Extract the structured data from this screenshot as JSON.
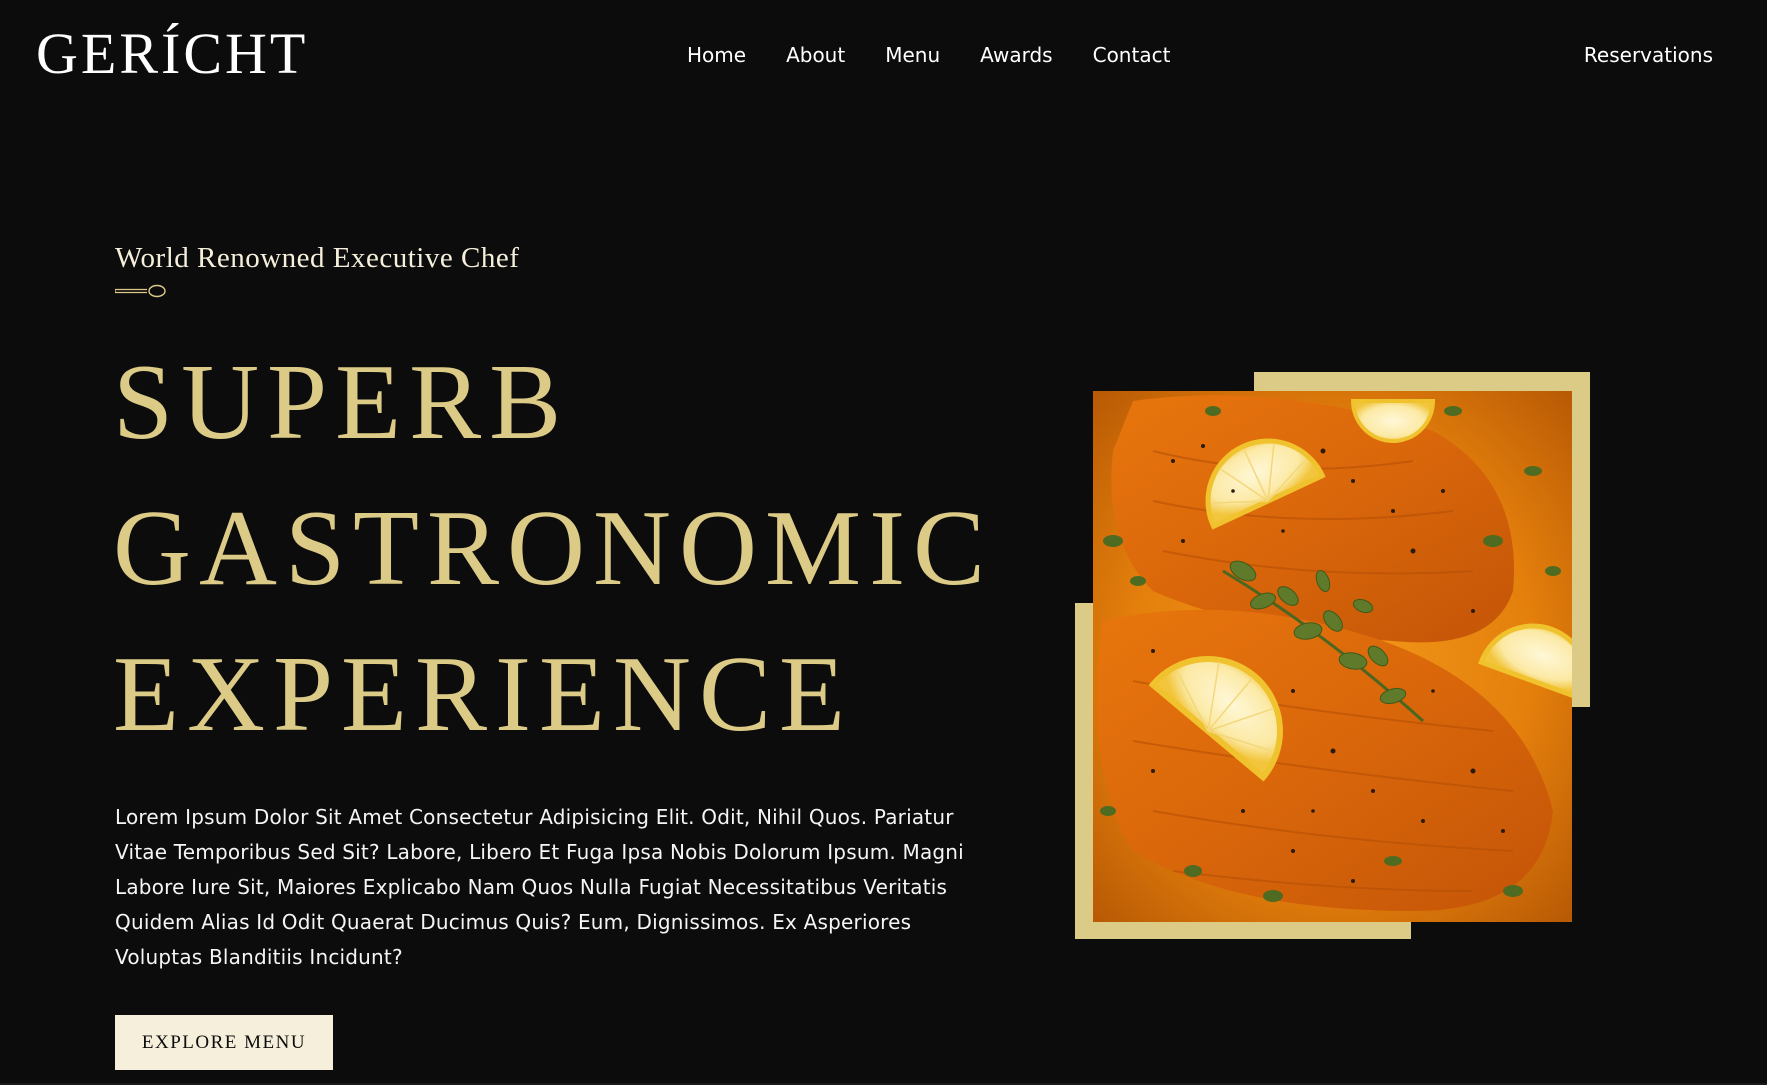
{
  "nav": {
    "logo": "GERÍCHT",
    "links": [
      "Home",
      "About",
      "Menu",
      "Awards",
      "Contact"
    ],
    "reservations": "Reservations"
  },
  "hero": {
    "subtitle": "World Renowned Executive Chef",
    "headline": [
      "SUPERB",
      "GASTRONOMIC",
      "EXPERIENCE"
    ],
    "description": "Lorem Ipsum Dolor Sit Amet Consectetur Adipisicing Elit. Odit, Nihil Quos. Pariatur Vitae Temporibus Sed Sit? Labore, Libero Et Fuga Ipsa Nobis Dolorum Ipsum. Magni Labore Iure Sit, Maiores Explicabo Nam Quos Nulla Fugiat Necessitatibus Veritatis Quidem Alias Id Odit Quaerat Ducimus Quis? Eum, Dignissimos. Ex Asperiores Voluptas Blanditiis Incidunt?",
    "cta_label": "EXPLORE MENU",
    "image_subject": "salmon-with-lemon-and-herbs"
  },
  "colors": {
    "background": "#0c0c0c",
    "gold": "#dcca87",
    "cream": "#f5efdb",
    "white": "#ffffff"
  },
  "icons": {
    "divider": "spoon-icon"
  }
}
